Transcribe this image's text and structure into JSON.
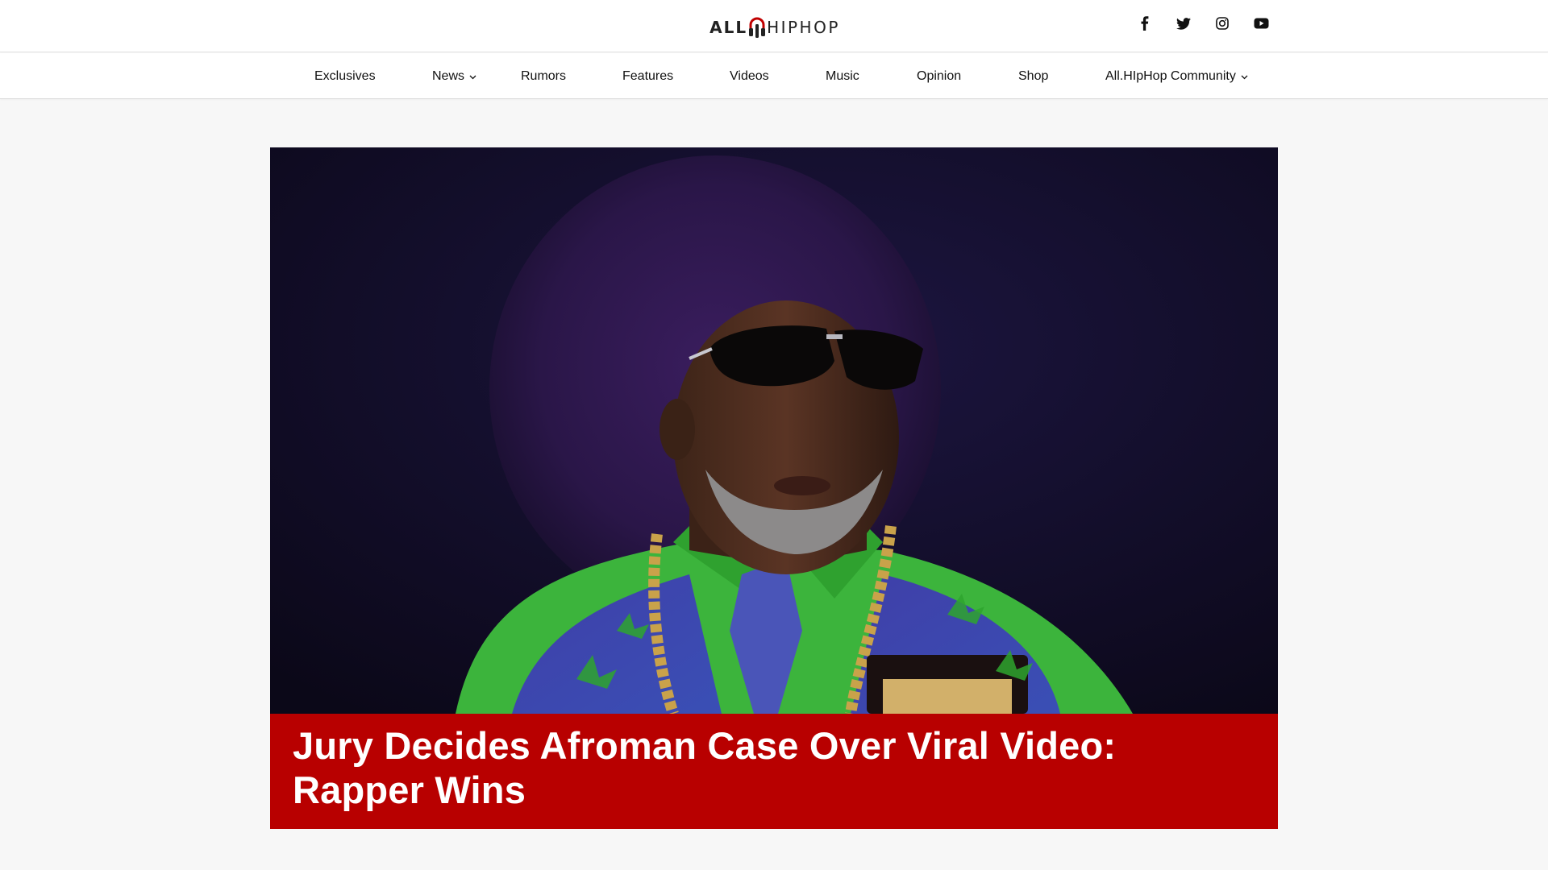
{
  "brand": {
    "logo_left": "ALL",
    "logo_right": "HIPHOP",
    "accent": "#b80000"
  },
  "social": [
    {
      "name": "facebook-icon"
    },
    {
      "name": "twitter-icon"
    },
    {
      "name": "instagram-icon"
    },
    {
      "name": "youtube-icon"
    }
  ],
  "nav": {
    "items": [
      {
        "label": "Exclusives"
      },
      {
        "label": "News",
        "dropdown": true
      },
      {
        "label": "Rumors"
      },
      {
        "label": "Features"
      },
      {
        "label": "Videos"
      },
      {
        "label": "Music"
      },
      {
        "label": "Opinion"
      },
      {
        "label": "Shop"
      },
      {
        "label": "All.HIpHop Community",
        "dropdown": true
      }
    ]
  },
  "hero": {
    "title": "Jury Decides Afroman Case Over Viral Video: Rapper Wins",
    "caption_color": "#b80000"
  }
}
